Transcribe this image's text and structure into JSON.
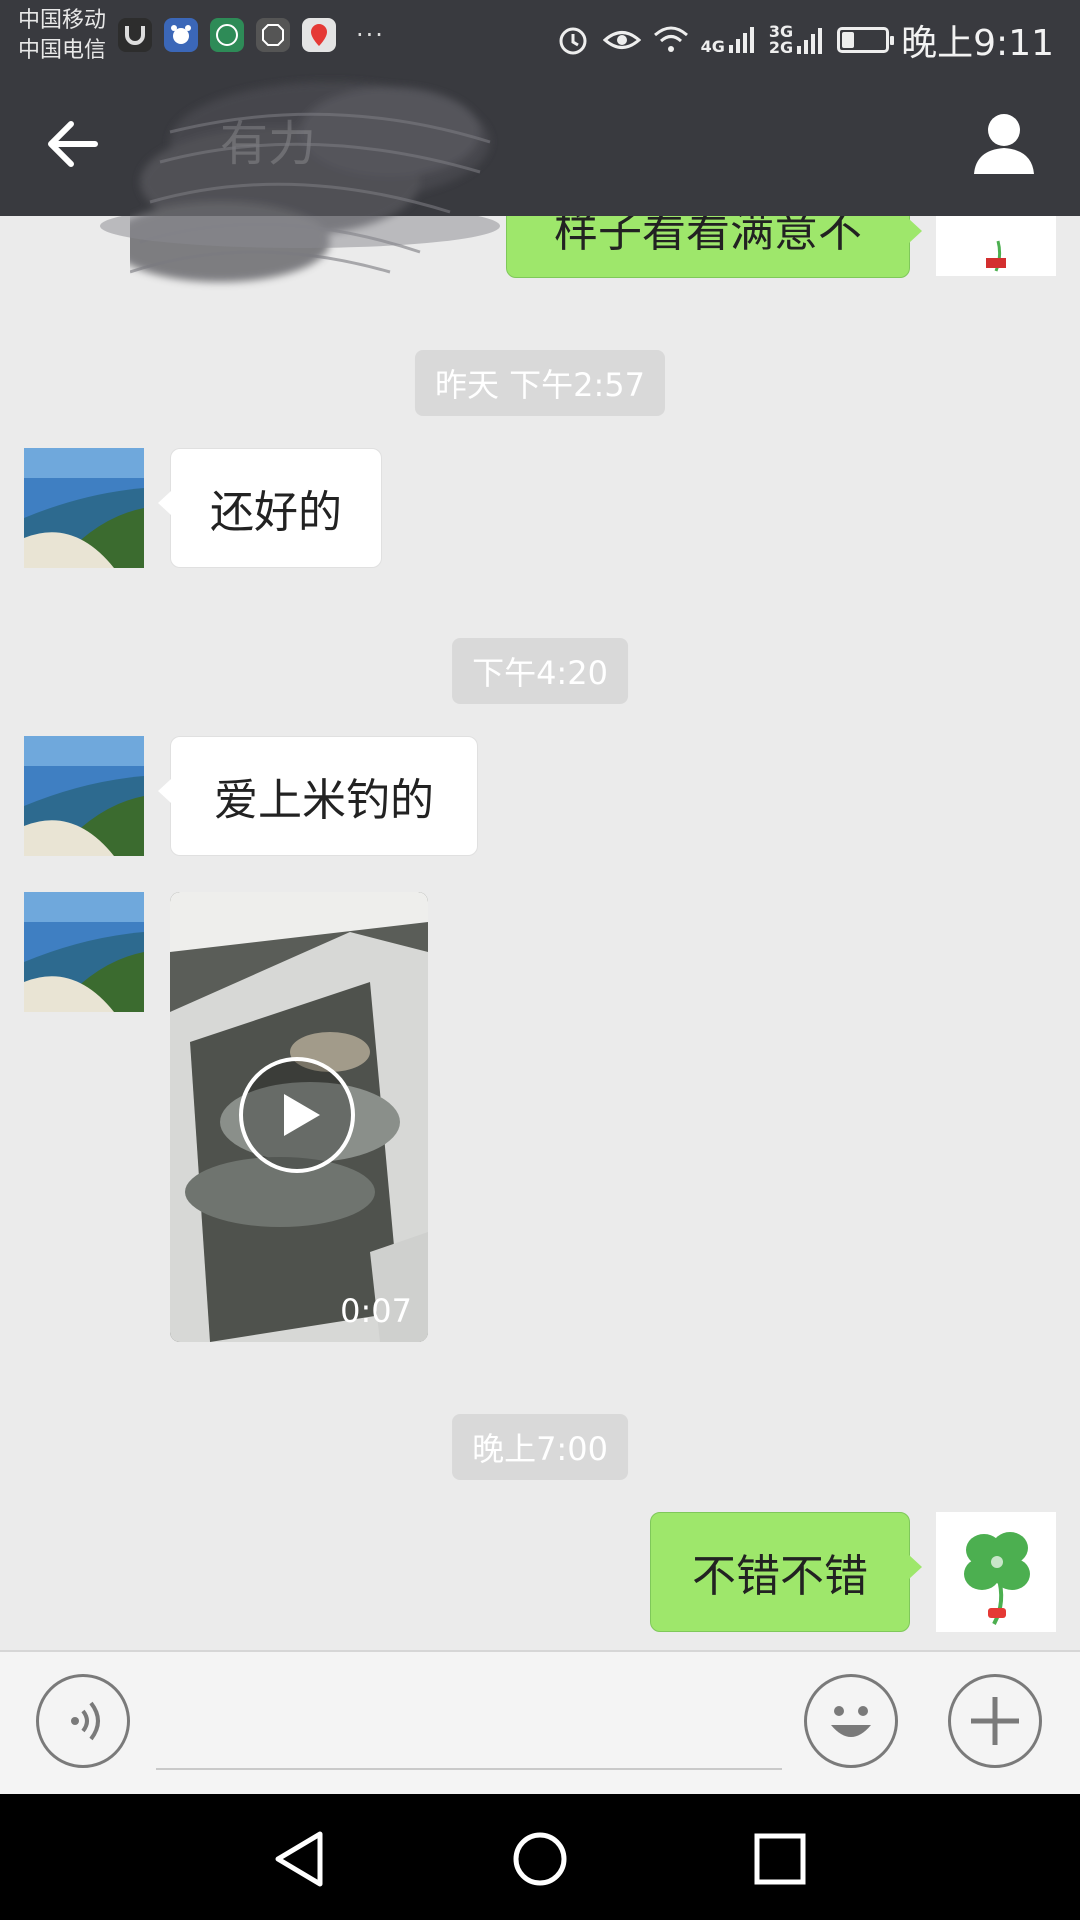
{
  "status_bar": {
    "carriers": [
      "中国移动",
      "中国电信"
    ],
    "network_labels": [
      "4G",
      "3G",
      "2G"
    ],
    "time": "晚上9:11",
    "battery_level": 0.25
  },
  "header": {
    "title": "有力"
  },
  "messages": [
    {
      "type": "text",
      "from": "me",
      "text": "样子看看满意不"
    },
    {
      "type": "timestamp",
      "text": "昨天 下午2:57"
    },
    {
      "type": "text",
      "from": "them",
      "text": "还好的"
    },
    {
      "type": "timestamp",
      "text": "下午4:20"
    },
    {
      "type": "text",
      "from": "them",
      "text": "爱上米钓的"
    },
    {
      "type": "video",
      "from": "them",
      "duration": "0:07"
    },
    {
      "type": "timestamp",
      "text": "晚上7:00"
    },
    {
      "type": "text",
      "from": "me",
      "text": "不错不错"
    }
  ],
  "input_bar": {
    "icons": [
      "voice-icon",
      "emoji-icon",
      "plus-icon"
    ]
  },
  "colors": {
    "header_bg": "#393a3f",
    "chat_bg": "#ebebeb",
    "outgoing_bubble": "#9ee76b",
    "incoming_bubble": "#ffffff"
  }
}
